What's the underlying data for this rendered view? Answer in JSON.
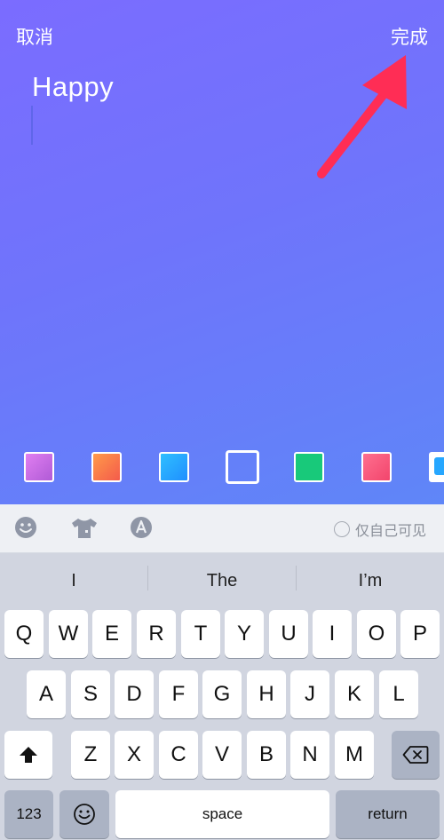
{
  "header": {
    "cancel_label": "取消",
    "done_label": "完成"
  },
  "editor": {
    "text": "Happy"
  },
  "swatches": [
    "purple",
    "orange",
    "blue",
    "outline-selected",
    "green",
    "pink",
    "more"
  ],
  "toolbar": {
    "private_label": "仅自己可见"
  },
  "suggestions": [
    "I",
    "The",
    "I’m"
  ],
  "keys": {
    "row1": [
      "Q",
      "W",
      "E",
      "R",
      "T",
      "Y",
      "U",
      "I",
      "O",
      "P"
    ],
    "row2": [
      "A",
      "S",
      "D",
      "F",
      "G",
      "H",
      "J",
      "K",
      "L"
    ],
    "row3": [
      "Z",
      "X",
      "C",
      "V",
      "B",
      "N",
      "M"
    ],
    "numbers": "123",
    "space": "space",
    "return": "return"
  },
  "colors": {
    "arrow": "#ff2d55",
    "keyboard_bg": "#d1d5e0"
  }
}
